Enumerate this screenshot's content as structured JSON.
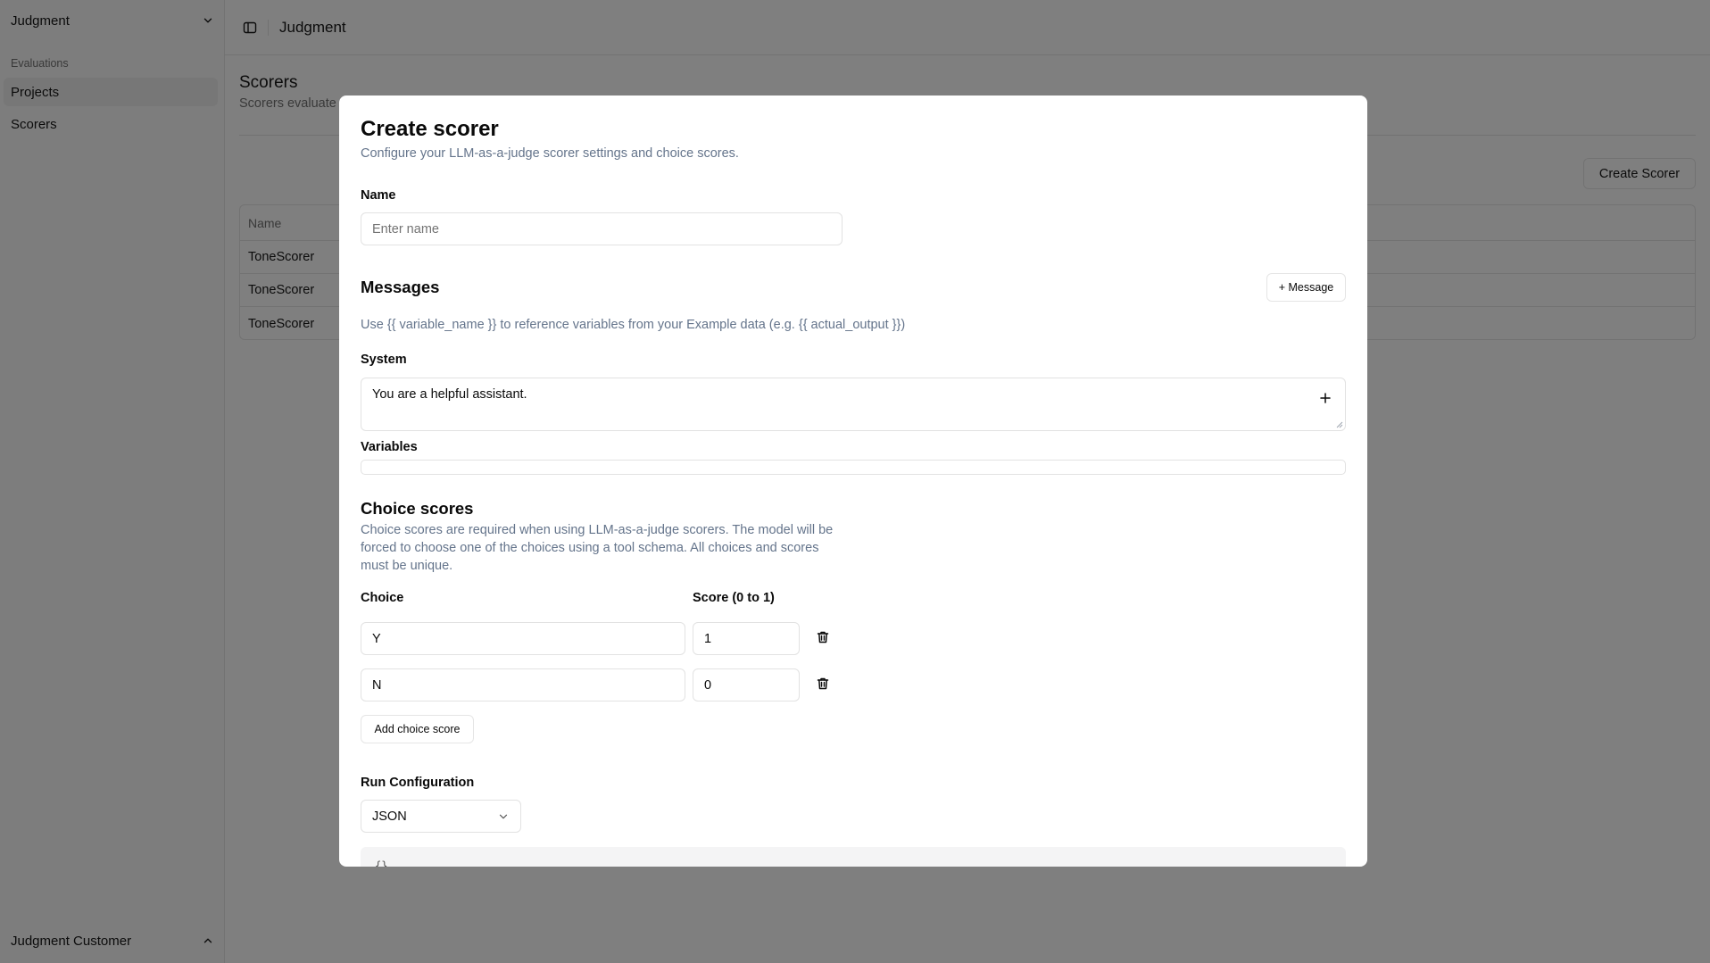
{
  "sidebar": {
    "workspace": "Judgment",
    "group_label": "Evaluations",
    "items": [
      {
        "label": "Projects",
        "active": true
      },
      {
        "label": "Scorers",
        "active": false
      }
    ],
    "footer_user": "Judgment Customer"
  },
  "topbar": {
    "title": "Judgment"
  },
  "page": {
    "title": "Scorers",
    "subtitle": "Scorers evaluate",
    "create_button": "Create Scorer",
    "table": {
      "header": "Name",
      "rows": [
        "ToneScorer",
        "ToneScorer",
        "ToneScorer"
      ]
    }
  },
  "modal": {
    "title": "Create scorer",
    "description": "Configure your LLM-as-a-judge scorer settings and choice scores.",
    "name_label": "Name",
    "name_placeholder": "Enter name",
    "messages_title": "Messages",
    "add_message_button": "+ Message",
    "messages_hint": "Use {{ variable_name }} to reference variables from your Example data (e.g. {{ actual_output }})",
    "system_label": "System",
    "system_value": "You are a helpful assistant.",
    "variables_label": "Variables",
    "choice_scores_title": "Choice scores",
    "choice_scores_desc": "Choice scores are required when using LLM-as-a-judge scorers. The model will be forced to choose one of the choices using a tool schema. All choices and scores must be unique.",
    "choice_col": "Choice",
    "score_col": "Score (0 to 1)",
    "choices": [
      {
        "choice": "Y",
        "score": "1"
      },
      {
        "choice": "N",
        "score": "0"
      }
    ],
    "add_choice_button": "Add choice score",
    "run_config_label": "Run Configuration",
    "run_config_value": "JSON",
    "code_preview": "{}"
  },
  "icons": {
    "workspace_chevron": "chevron-down-icon",
    "footer_chevron": "chevron-up-icon",
    "panel_toggle": "sidebar-toggle-icon",
    "add": "plus-icon",
    "delete": "trash-icon"
  }
}
